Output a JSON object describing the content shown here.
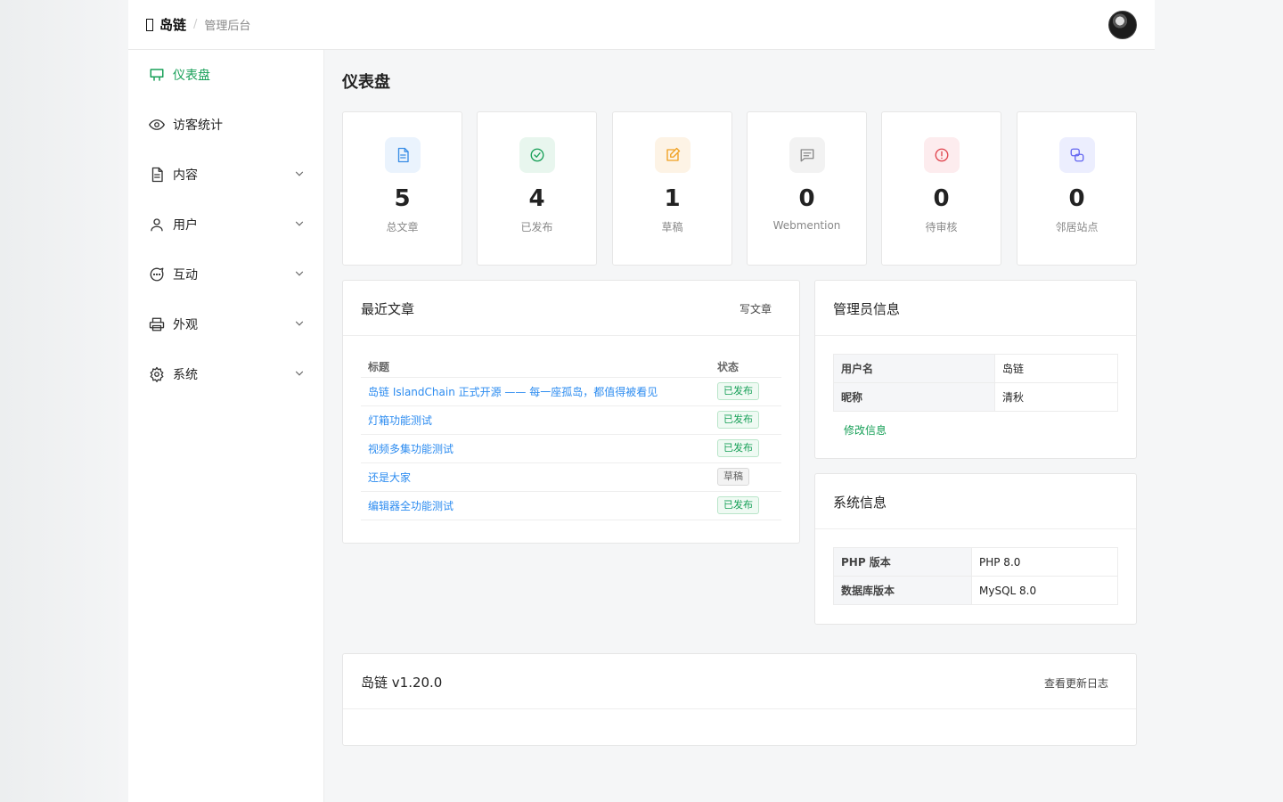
{
  "colors": {
    "accent": "#18a058",
    "link": "#2d8cf0"
  },
  "topbar": {
    "brand": "岛链",
    "separator": "/",
    "subtitle": "管理后台"
  },
  "sidebar": {
    "items": [
      {
        "label": "仪表盘",
        "icon": "dashboard-icon",
        "active": true
      },
      {
        "label": "访客统计",
        "icon": "eye-icon"
      },
      {
        "label": "内容",
        "icon": "document-icon"
      },
      {
        "label": "用户",
        "icon": "user-icon"
      },
      {
        "label": "互动",
        "icon": "chat-icon"
      },
      {
        "label": "外观",
        "icon": "printer-icon"
      },
      {
        "label": "系统",
        "icon": "gear-icon"
      }
    ]
  },
  "page": {
    "title": "仪表盘"
  },
  "stats": [
    {
      "value": "5",
      "label": "总文章",
      "icon": "document-icon",
      "color": "#3a8ee6"
    },
    {
      "value": "4",
      "label": "已发布",
      "icon": "check-circle-icon",
      "color": "#18a058"
    },
    {
      "value": "1",
      "label": "草稿",
      "icon": "edit-icon",
      "color": "#f0a020"
    },
    {
      "value": "0",
      "label": "Webmention",
      "icon": "message-icon",
      "color": "#888888"
    },
    {
      "value": "0",
      "label": "待审核",
      "icon": "alert-icon",
      "color": "#e0454f"
    },
    {
      "value": "0",
      "label": "邻居站点",
      "icon": "link-icon",
      "color": "#6366f1"
    }
  ],
  "recent_posts": {
    "title": "最近文章",
    "action": "写文章",
    "columns": [
      "标题",
      "状态"
    ],
    "rows": [
      {
        "title": "岛链 IslandChain 正式开源 —— 每一座孤岛，都值得被看见",
        "status": "已发布"
      },
      {
        "title": "灯箱功能测试",
        "status": "已发布"
      },
      {
        "title": "视频多集功能测试",
        "status": "已发布"
      },
      {
        "title": "还是大家",
        "status": "草稿"
      },
      {
        "title": "编辑器全功能测试",
        "status": "已发布"
      }
    ]
  },
  "admin_info": {
    "title": "管理员信息",
    "rows": [
      {
        "key": "用户名",
        "value": "岛链"
      },
      {
        "key": "昵称",
        "value": "清秋"
      }
    ],
    "edit_label": "修改信息"
  },
  "system_info": {
    "title": "系统信息",
    "rows": [
      {
        "key": "PHP 版本",
        "value": "PHP 8.0"
      },
      {
        "key": "数据库版本",
        "value": "MySQL 8.0"
      }
    ]
  },
  "version": {
    "title": "岛链 v1.20.0",
    "changelog_label": "查看更新日志"
  }
}
